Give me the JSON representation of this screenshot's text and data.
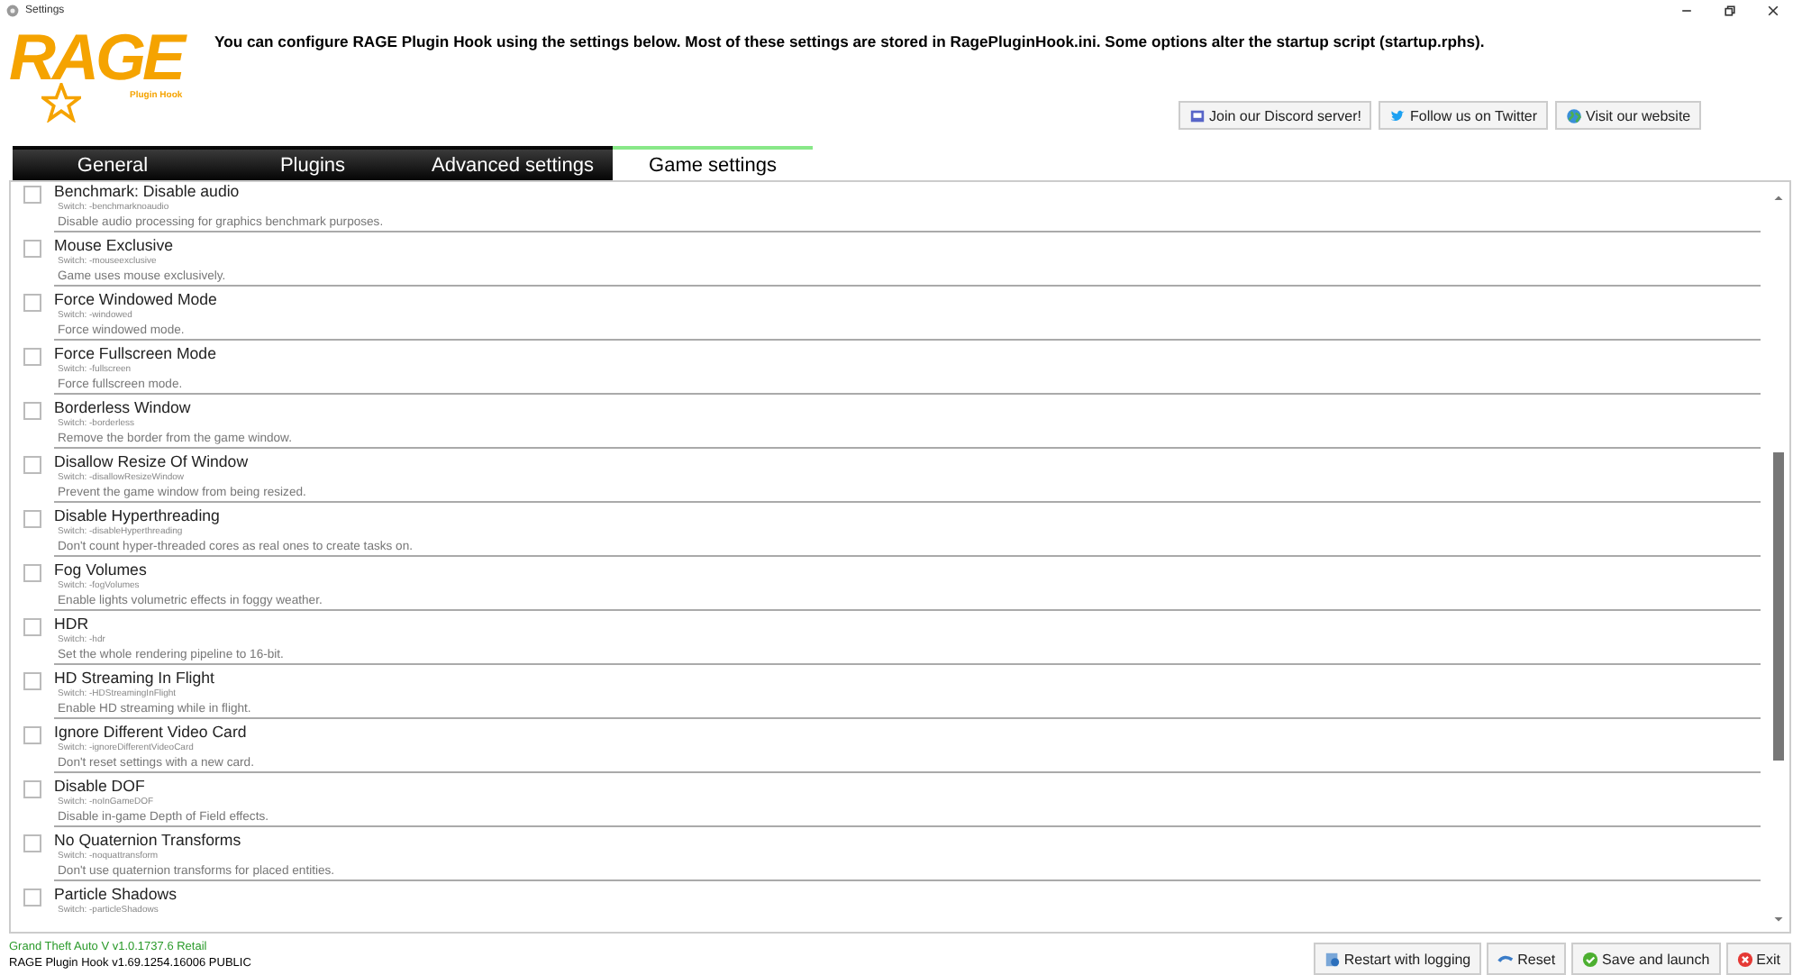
{
  "window": {
    "title": "Settings"
  },
  "logo": {
    "text": "RAGE",
    "subtitle": "Plugin Hook"
  },
  "intro": "You can configure RAGE Plugin Hook using the settings below. Most of these settings are stored in RagePluginHook.ini. Some options alter the startup script (startup.rphs).",
  "links": [
    {
      "label": "Join our Discord server!",
      "kind": "discord"
    },
    {
      "label": "Follow us on Twitter",
      "kind": "twitter"
    },
    {
      "label": "Visit our website",
      "kind": "web"
    }
  ],
  "tabs": [
    {
      "label": "General",
      "selected": false
    },
    {
      "label": "Plugins",
      "selected": false
    },
    {
      "label": "Advanced settings",
      "selected": false
    },
    {
      "label": "Game settings",
      "selected": true
    }
  ],
  "settings": [
    {
      "title": "Benchmark: Disable audio",
      "switch": "Switch: -benchmarknoaudio",
      "description": "Disable audio processing for graphics benchmark purposes.",
      "checked": false
    },
    {
      "title": "Mouse Exclusive",
      "switch": "Switch: -mouseexclusive",
      "description": "Game uses mouse exclusively.",
      "checked": false
    },
    {
      "title": "Force Windowed Mode",
      "switch": "Switch: -windowed",
      "description": "Force windowed mode.",
      "checked": false
    },
    {
      "title": "Force Fullscreen Mode",
      "switch": "Switch: -fullscreen",
      "description": "Force fullscreen mode.",
      "checked": false
    },
    {
      "title": "Borderless Window",
      "switch": "Switch: -borderless",
      "description": "Remove the border from the game window.",
      "checked": false
    },
    {
      "title": "Disallow Resize Of Window",
      "switch": "Switch: -disallowResizeWindow",
      "description": "Prevent the game window from being resized.",
      "checked": false
    },
    {
      "title": "Disable Hyperthreading",
      "switch": "Switch: -disableHyperthreading",
      "description": "Don't count hyper-threaded cores as real ones to create tasks on.",
      "checked": false
    },
    {
      "title": "Fog Volumes",
      "switch": "Switch: -fogVolumes",
      "description": "Enable lights volumetric effects in foggy weather.",
      "checked": false
    },
    {
      "title": "HDR",
      "switch": "Switch: -hdr",
      "description": "Set the whole rendering pipeline to 16-bit.",
      "checked": false
    },
    {
      "title": "HD Streaming In Flight",
      "switch": "Switch: -HDStreamingInFlight",
      "description": "Enable HD streaming while in flight.",
      "checked": false
    },
    {
      "title": "Ignore Different Video Card",
      "switch": "Switch: -ignoreDifferentVideoCard",
      "description": "Don't reset settings with a new card.",
      "checked": false
    },
    {
      "title": "Disable DOF",
      "switch": "Switch: -noInGameDOF",
      "description": "Disable in-game Depth of Field effects.",
      "checked": false
    },
    {
      "title": "No Quaternion Transforms",
      "switch": "Switch: -noquattransform",
      "description": "Don't use quaternion transforms for placed entities.",
      "checked": false
    },
    {
      "title": "Particle Shadows",
      "switch": "Switch: -particleShadows",
      "checked": false
    }
  ],
  "status": {
    "game": "Grand Theft Auto V v1.0.1737.6 Retail",
    "hook": "RAGE Plugin Hook v1.69.1254.16006 PUBLIC"
  },
  "buttons": [
    {
      "label": "Restart with logging",
      "kind": "restart"
    },
    {
      "label": "Reset",
      "kind": "reset"
    },
    {
      "label": "Save and launch",
      "kind": "save"
    },
    {
      "label": "Exit",
      "kind": "exit"
    }
  ]
}
